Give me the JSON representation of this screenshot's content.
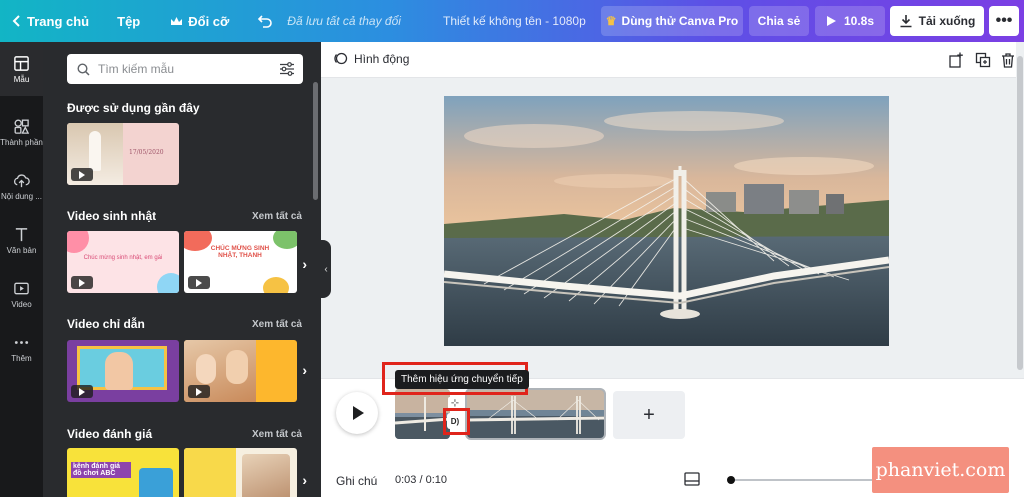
{
  "topbar": {
    "home_label": "Trang chủ",
    "file_label": "Tệp",
    "resize_label": "Đổi cỡ",
    "saved_status": "Đã lưu tất cả thay đổi",
    "design_title": "Thiết kế không tên - 1080p",
    "pro_label": "Dùng thử Canva Pro",
    "share_label": "Chia sẻ",
    "duration_label": "10.8s",
    "download_label": "Tải xuống",
    "more_label": "•••"
  },
  "rail": {
    "items": [
      {
        "label": "Mẫu",
        "icon": "templates-icon"
      },
      {
        "label": "Thành phần",
        "icon": "elements-icon"
      },
      {
        "label": "Nội dung ...",
        "icon": "uploads-icon"
      },
      {
        "label": "Văn bản",
        "icon": "text-icon"
      },
      {
        "label": "Video",
        "icon": "video-icon"
      },
      {
        "label": "Thêm",
        "icon": "more-icon"
      }
    ]
  },
  "panel": {
    "search_placeholder": "Tìm kiếm mẫu",
    "sections": [
      {
        "title": "Được sử dụng gần đây",
        "see_all": "",
        "thumbs": [
          {
            "text": "17/05/2020"
          }
        ]
      },
      {
        "title": "Video sinh nhật",
        "see_all": "Xem tất cả",
        "thumbs": [
          {
            "text": "Chúc mừng sinh nhật, em gái"
          },
          {
            "text": "CHÚC MỪNG SINH NHẬT, THANH"
          }
        ]
      },
      {
        "title": "Video chỉ dẫn",
        "see_all": "Xem tất cả",
        "thumbs": [
          {
            "text": ""
          },
          {
            "text": ""
          }
        ]
      },
      {
        "title": "Video đánh giá",
        "see_all": "Xem tất cả",
        "thumbs": [
          {
            "text": "kênh đánh giá đồ chơi ABC"
          },
          {
            "text": ""
          }
        ]
      }
    ]
  },
  "editor": {
    "animate_label": "Hình động"
  },
  "timeline": {
    "tooltip": "Thêm hiệu ứng chuyển tiếp",
    "transition_label": "D)",
    "add_label": "+",
    "notes_label": "Ghi chú",
    "time_label": "0:03 / 0:10"
  },
  "watermark": "phanviet.com",
  "colors": {
    "accent_red": "#e0241b",
    "panel_dark": "#292b2e",
    "rail_dark": "#18191b"
  }
}
